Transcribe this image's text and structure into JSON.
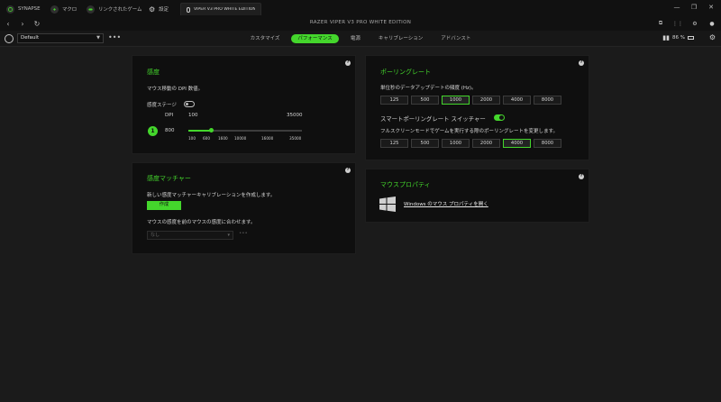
{
  "tabs": [
    {
      "label": "SYNAPSE",
      "icon": "synapse-icon"
    },
    {
      "label": "マクロ",
      "icon": "macro-icon"
    },
    {
      "label": "リンクされたゲーム",
      "icon": "linked-games-icon"
    },
    {
      "label": "設定",
      "icon": "gear-icon"
    },
    {
      "label": "VIPER V3 PRO WHITE EDITION",
      "icon": "mouse-icon"
    }
  ],
  "window": {
    "title": "RAZER VIPER V3 PRO WHITE EDITION"
  },
  "profile": {
    "selected": "Default"
  },
  "main_tabs": [
    {
      "label": "カスタマイズ"
    },
    {
      "label": "パフォーマンス"
    },
    {
      "label": "電源"
    },
    {
      "label": "キャリブレーション"
    },
    {
      "label": "アドバンスト"
    }
  ],
  "battery": {
    "percent": "86 %"
  },
  "sensitivity": {
    "title": "感度",
    "desc": "マウス移動の DPI 数値。",
    "stage_label": "感度ステージ",
    "stage_toggle": false,
    "dpi_label": "DPI",
    "dpi_min": "100",
    "dpi_max": "35000",
    "stage_number": "1",
    "current_dpi": "800",
    "slider_fraction": 0.02,
    "ticks": [
      "100",
      "600",
      "1600",
      "10000",
      "16000",
      "35000"
    ]
  },
  "polling": {
    "title": "ポーリングレート",
    "desc": "単位秒のデータアップデートの頻度 (Hz)。",
    "rates": [
      "125",
      "500",
      "1000",
      "2000",
      "4000",
      "8000"
    ],
    "selected": "1000",
    "switcher_label": "スマートポーリングレート スイッチャー",
    "switcher_on": true,
    "fullscreen_desc": "フルスクリーンモードでゲームを実行する際のポーリングレートを変更します。",
    "fullscreen_rates": [
      "125",
      "500",
      "1000",
      "2000",
      "4000",
      "8000"
    ],
    "fullscreen_selected": "4000"
  },
  "matcher": {
    "title": "感度マッチャー",
    "desc": "新しい感度マッチャーキャリブレーションを作成します。",
    "create_button": "作成",
    "match_desc": "マウスの感度を前のマウスの感度に合わせます。",
    "dropdown_value": "なし"
  },
  "mouse_props": {
    "title": "マウスプロパティ",
    "link": "Windows のマウス プロパティを開く"
  },
  "colors": {
    "accent": "#44d62c",
    "panel": "#0f0f0f",
    "bg": "#1b1b1b"
  }
}
